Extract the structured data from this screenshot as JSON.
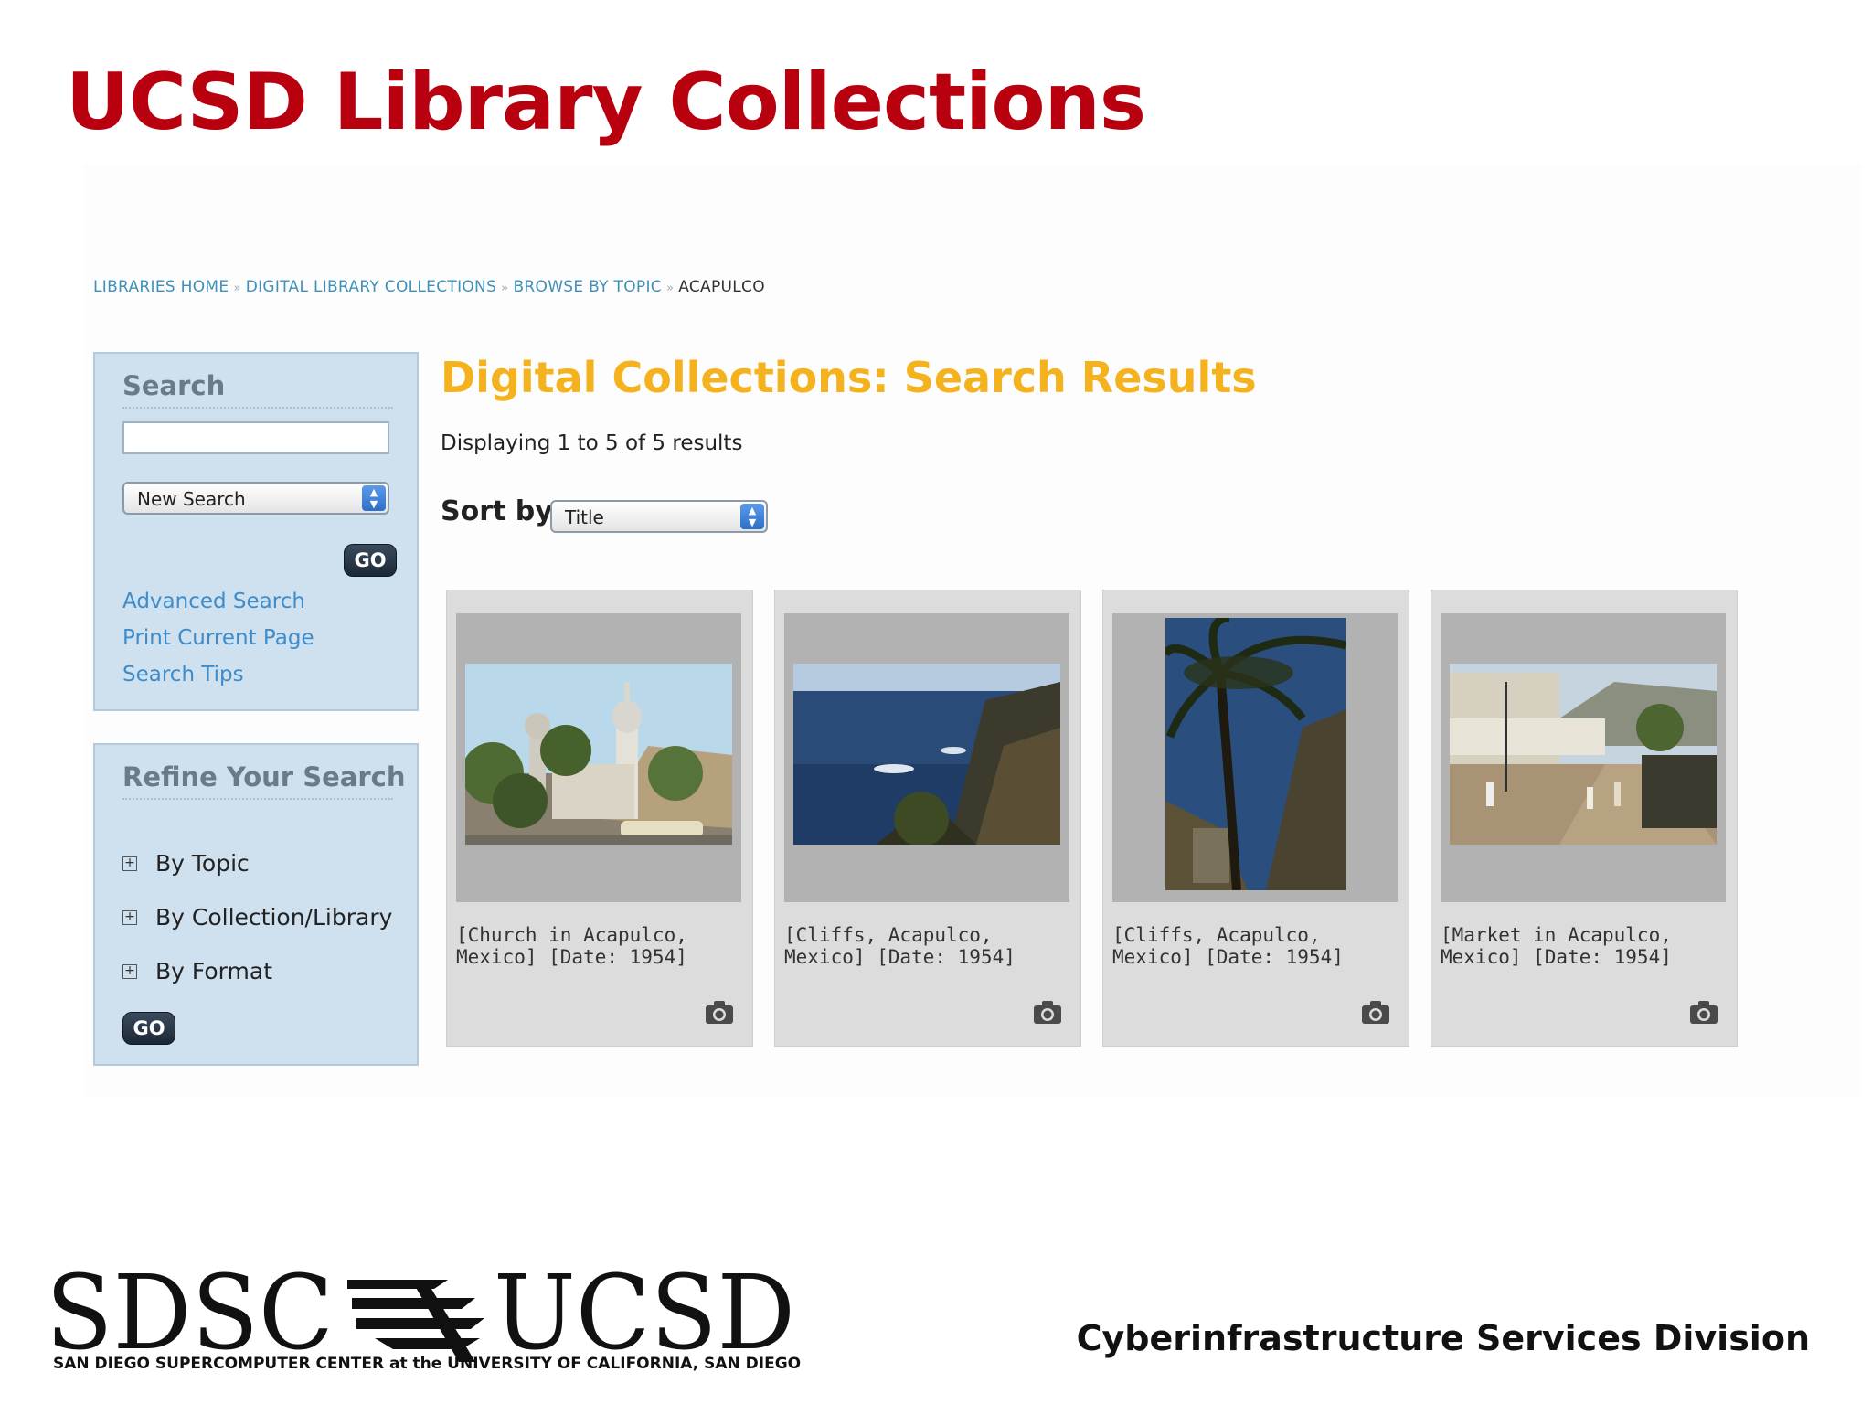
{
  "slide": {
    "title": "UCSD Library Collections",
    "footer_tagline": "SAN DIEGO SUPERCOMPUTER CENTER  at the UNIVERSITY OF CALIFORNIA, SAN DIEGO",
    "footer_division": "Cyberinfrastructure Services Division",
    "logo_text": "SDSC UCSD",
    "title_color": "#b8000f"
  },
  "breadcrumb": [
    {
      "label": "LIBRARIES HOME",
      "link": true
    },
    {
      "label": "DIGITAL LIBRARY COLLECTIONS",
      "link": true
    },
    {
      "label": "BROWSE BY TOPIC",
      "link": true
    },
    {
      "label": "ACAPULCO",
      "link": false
    }
  ],
  "breadcrumb_separator": "»",
  "search_panel": {
    "heading": "Search",
    "input_value": "",
    "mode_select": "New Search",
    "go_label": "GO",
    "links": [
      "Advanced Search",
      "Print Current Page",
      "Search Tips"
    ]
  },
  "refine_panel": {
    "heading": "Refine Your Search",
    "items": [
      "By Topic",
      "By Collection/Library",
      "By Format"
    ],
    "go_label": "GO"
  },
  "results": {
    "title": "Digital Collections: Search Results",
    "count_text": "Displaying 1 to 5 of 5 results",
    "sort_label": "Sort by",
    "sort_value": "Title",
    "title_color": "#f5b21f",
    "items": [
      {
        "caption": "[Church in Acapulco, Mexico] [Date: 1954]",
        "icon": "camera-icon"
      },
      {
        "caption": "[Cliffs, Acapulco, Mexico] [Date: 1954]",
        "icon": "camera-icon"
      },
      {
        "caption": "[Cliffs, Acapulco, Mexico] [Date: 1954]",
        "icon": "camera-icon"
      },
      {
        "caption": "[Market in Acapulco, Mexico] [Date: 1954]",
        "icon": "camera-icon"
      }
    ]
  }
}
